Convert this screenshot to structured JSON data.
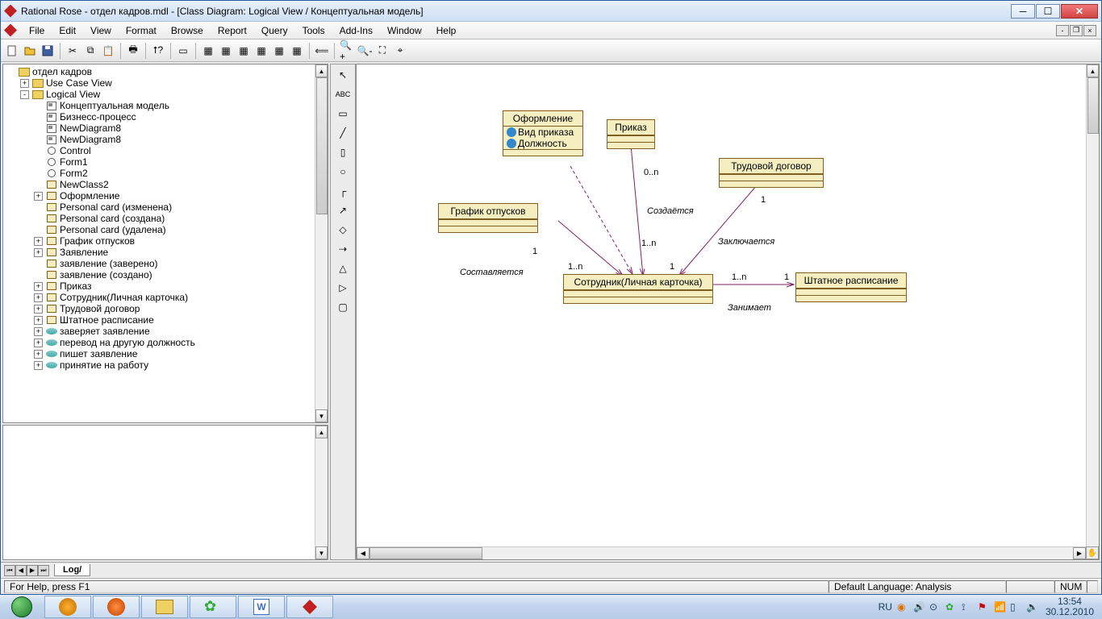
{
  "titlebar": {
    "title": "Rational Rose - отдел кадров.mdl - [Class Diagram: Logical View / Концептуальная модель]"
  },
  "menu": {
    "items": [
      "File",
      "Edit",
      "View",
      "Format",
      "Browse",
      "Report",
      "Query",
      "Tools",
      "Add-Ins",
      "Window",
      "Help"
    ]
  },
  "tree": {
    "root": "отдел кадров",
    "use_case": "Use Case View",
    "logical": "Logical View",
    "items": [
      {
        "ic": "diagram",
        "t": "Концептуальная модель"
      },
      {
        "ic": "diagram",
        "t": "Бизнесс-процесс"
      },
      {
        "ic": "diagram",
        "t": "NewDiagram8"
      },
      {
        "ic": "diagram",
        "t": "NewDiagram8"
      },
      {
        "ic": "circle",
        "t": "Control"
      },
      {
        "ic": "circle",
        "t": "Form1"
      },
      {
        "ic": "circle",
        "t": "Form2"
      },
      {
        "ic": "class",
        "t": "NewClass2"
      },
      {
        "ic": "class",
        "t": "Оформление",
        "exp": "+"
      },
      {
        "ic": "class",
        "t": "Personal card (изменена)"
      },
      {
        "ic": "class",
        "t": "Personal card (создана)"
      },
      {
        "ic": "class",
        "t": "Personal card (удалена)"
      },
      {
        "ic": "class",
        "t": "График отпусков",
        "exp": "+"
      },
      {
        "ic": "class",
        "t": "Заявление",
        "exp": "+"
      },
      {
        "ic": "class",
        "t": "заявление (заверено)"
      },
      {
        "ic": "class",
        "t": "заявление (создано)"
      },
      {
        "ic": "class",
        "t": "Приказ",
        "exp": "+"
      },
      {
        "ic": "class",
        "t": "Сотрудник(Личная карточка)",
        "exp": "+"
      },
      {
        "ic": "class",
        "t": "Трудовой договор",
        "exp": "+"
      },
      {
        "ic": "class",
        "t": "Штатное расписание",
        "exp": "+"
      },
      {
        "ic": "assoc",
        "t": "заверяет заявление",
        "exp": "+"
      },
      {
        "ic": "assoc",
        "t": "перевод на другую должность",
        "exp": "+"
      },
      {
        "ic": "assoc",
        "t": "пишет заявление",
        "exp": "+"
      },
      {
        "ic": "assoc",
        "t": "принятие на работу",
        "exp": "+"
      }
    ]
  },
  "diagram": {
    "classes": {
      "oformlenie": {
        "name": "Оформление",
        "attrs": [
          "Вид приказа",
          "Должность"
        ]
      },
      "prikaz": {
        "name": "Приказ"
      },
      "trudovoy": {
        "name": "Трудовой договор"
      },
      "grafik": {
        "name": "График отпусков"
      },
      "sotrudnik": {
        "name": "Сотрудник(Личная карточка)"
      },
      "shtat": {
        "name": "Штатное расписание"
      }
    },
    "labels": {
      "sozdaetsya": "Создаётся",
      "zakluchaetsya": "Заключается",
      "sostavlyaetsya": "Составляется",
      "zanimaet": "Занимает"
    },
    "mult": {
      "one": "1",
      "zero_n": "0..n",
      "one_n": "1..n"
    }
  },
  "tabbar": {
    "log": "Log/"
  },
  "status": {
    "help": "For Help, press F1",
    "lang": "Default Language: Analysis",
    "num": "NUM"
  },
  "taskbar": {
    "kb": "RU",
    "time": "13:54",
    "date": "30.12.2010"
  }
}
